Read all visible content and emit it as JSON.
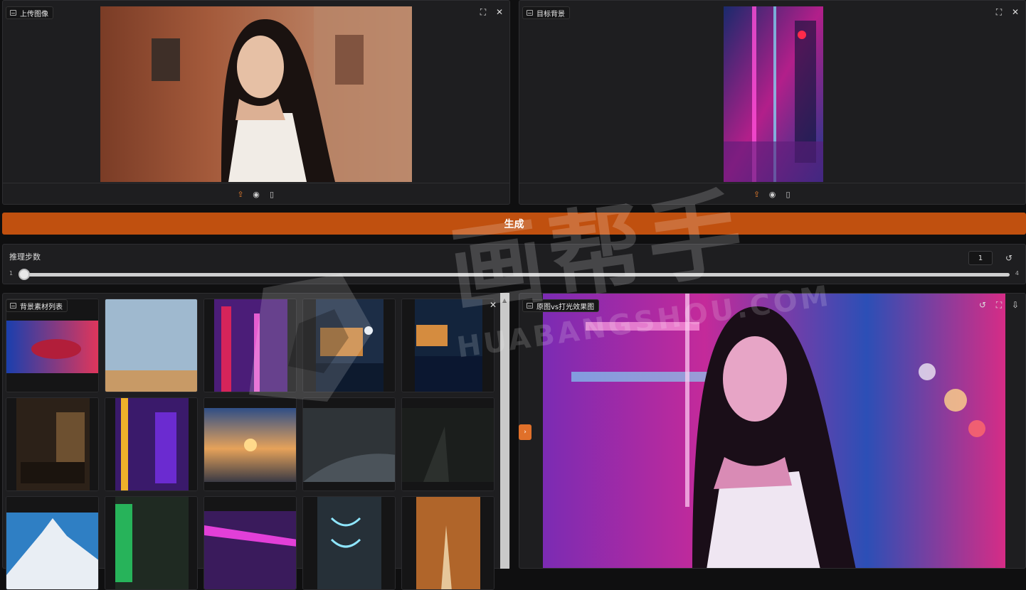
{
  "upload_panel": {
    "title": "上传图像"
  },
  "target_panel": {
    "title": "目标背景"
  },
  "generate_button": {
    "label": "生成"
  },
  "steps": {
    "label": "推理步数",
    "value": "1",
    "min": "1",
    "max": "4"
  },
  "gallery": {
    "title": "背景素材列表",
    "count": 15
  },
  "compare_panel": {
    "title": "原图vs打光效果图"
  },
  "watermark": {
    "main": "画帮手",
    "sub": "HUABANGSHOU.COM"
  },
  "icons": {
    "expand": "⛶",
    "close": "✕",
    "upload": "⇪",
    "webcam": "◉",
    "clipboard": "▯",
    "reset": "↺",
    "undo": "↺",
    "download": "⇩",
    "arrow": "›"
  }
}
